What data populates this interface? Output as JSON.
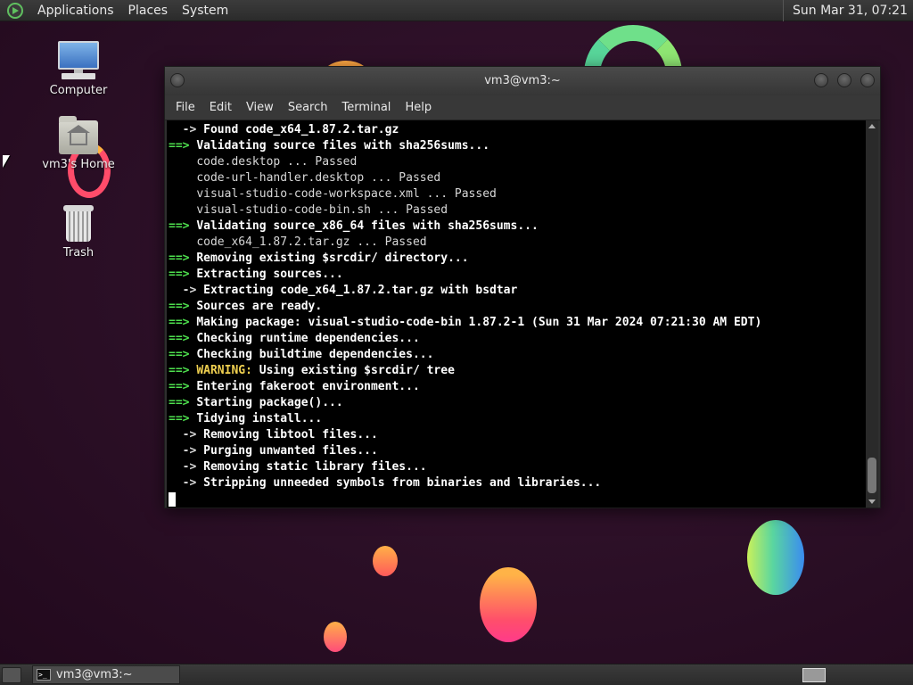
{
  "top_panel": {
    "menus": [
      "Applications",
      "Places",
      "System"
    ],
    "clock": "Sun Mar 31, 07:21"
  },
  "desktop_icons": {
    "computer": "Computer",
    "home": "vm3's Home",
    "trash": "Trash"
  },
  "terminal": {
    "title": "vm3@vm3:~",
    "menu": [
      "File",
      "Edit",
      "View",
      "Search",
      "Terminal",
      "Help"
    ],
    "lines": [
      {
        "prefix": "  -> ",
        "text": "Found code_x64_1.87.2.tar.gz"
      },
      {
        "prefix": "==> ",
        "text": "Validating source files with sha256sums..."
      },
      {
        "prefix": "    ",
        "text": "code.desktop ... Passed"
      },
      {
        "prefix": "    ",
        "text": "code-url-handler.desktop ... Passed"
      },
      {
        "prefix": "    ",
        "text": "visual-studio-code-workspace.xml ... Passed"
      },
      {
        "prefix": "    ",
        "text": "visual-studio-code-bin.sh ... Passed"
      },
      {
        "prefix": "==> ",
        "text": "Validating source_x86_64 files with sha256sums..."
      },
      {
        "prefix": "    ",
        "text": "code_x64_1.87.2.tar.gz ... Passed"
      },
      {
        "prefix": "==> ",
        "text": "Removing existing $srcdir/ directory..."
      },
      {
        "prefix": "==> ",
        "text": "Extracting sources..."
      },
      {
        "prefix": "  -> ",
        "text": "Extracting code_x64_1.87.2.tar.gz with bsdtar"
      },
      {
        "prefix": "==> ",
        "text": "Sources are ready."
      },
      {
        "prefix": "==> ",
        "text": "Making package: visual-studio-code-bin 1.87.2-1 (Sun 31 Mar 2024 07:21:30 AM EDT)"
      },
      {
        "prefix": "==> ",
        "text": "Checking runtime dependencies..."
      },
      {
        "prefix": "==> ",
        "text": "Checking buildtime dependencies..."
      },
      {
        "prefix": "==> ",
        "warning": "WARNING:",
        "text": " Using existing $srcdir/ tree"
      },
      {
        "prefix": "==> ",
        "text": "Entering fakeroot environment..."
      },
      {
        "prefix": "==> ",
        "text": "Starting package()..."
      },
      {
        "prefix": "==> ",
        "text": "Tidying install..."
      },
      {
        "prefix": "  -> ",
        "text": "Removing libtool files..."
      },
      {
        "prefix": "  -> ",
        "text": "Purging unwanted files..."
      },
      {
        "prefix": "  -> ",
        "text": "Removing static library files..."
      },
      {
        "prefix": "  -> ",
        "text": "Stripping unneeded symbols from binaries and libraries..."
      }
    ]
  },
  "taskbar": {
    "task_label": "vm3@vm3:~",
    "task_icon_text": ">_"
  },
  "colors": {
    "prompt_green": "#4ee04e",
    "warning_yellow": "#f0d050",
    "terminal_bg": "#000000"
  },
  "icons": [
    "menu-logo-icon",
    "computer-icon",
    "home-folder-icon",
    "trash-icon",
    "terminal-icon",
    "mouse-cursor-icon"
  ]
}
